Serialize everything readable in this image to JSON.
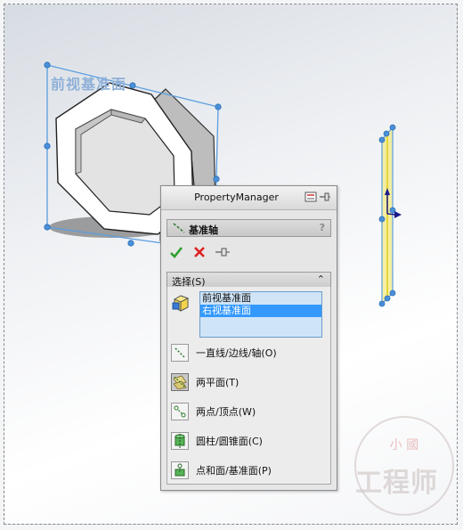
{
  "viewport": {
    "plane_label": "前视基准面"
  },
  "property_manager": {
    "title": "PropertyManager",
    "feature_name": "基准轴",
    "help": "?",
    "selection_group": {
      "label": "选择(S)",
      "chevron": "⌃",
      "items": [
        {
          "label": "前视基准面",
          "selected": false
        },
        {
          "label": "右视基准面",
          "selected": true
        }
      ]
    },
    "options": [
      {
        "label": "一直线/边线/轴(O)",
        "icon": "line-edge-axis-icon",
        "active": false
      },
      {
        "label": "两平面(T)",
        "icon": "two-planes-icon",
        "active": true
      },
      {
        "label": "两点/顶点(W)",
        "icon": "two-points-icon",
        "active": false
      },
      {
        "label": "圆柱/圆锥面(C)",
        "icon": "cylinder-cone-icon",
        "active": false
      },
      {
        "label": "点和面/基准面(P)",
        "icon": "point-plane-icon",
        "active": false
      }
    ]
  },
  "watermark": {
    "top_text": "小 國",
    "text": "工程师"
  },
  "colors": {
    "accent": "#3399ff",
    "plane_outline": "#5a9ee0",
    "handle": "#4a90d9",
    "axis_yellow": "#f2e65a"
  }
}
